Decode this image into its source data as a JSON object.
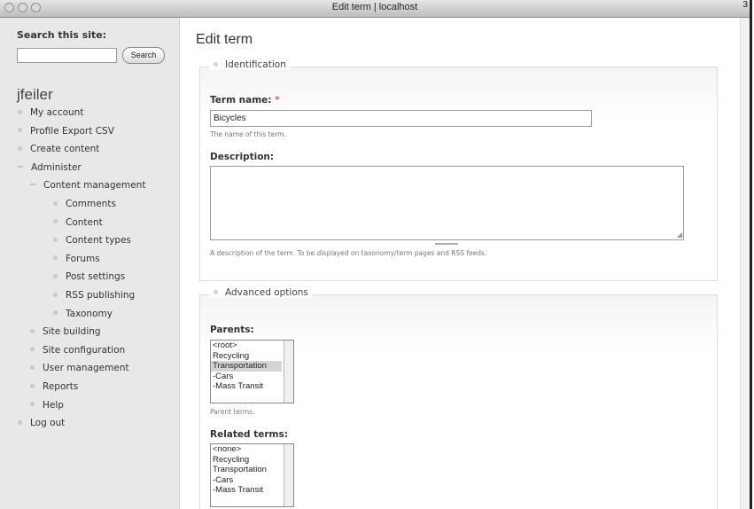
{
  "window": {
    "title": "Edit term | localhost",
    "corner_mark": "3"
  },
  "sidebar": {
    "search": {
      "label": "Search this site:",
      "value": "",
      "button": "Search"
    },
    "username": "jfeiler",
    "nav": [
      {
        "label": "My account",
        "level": 0
      },
      {
        "label": "Profile Export CSV",
        "level": 0
      },
      {
        "label": "Create content",
        "level": 0
      },
      {
        "label": "Administer",
        "level": 0,
        "expanded": true
      },
      {
        "label": "Content management",
        "level": 1,
        "expanded": true
      },
      {
        "label": "Comments",
        "level": 2
      },
      {
        "label": "Content",
        "level": 2
      },
      {
        "label": "Content types",
        "level": 2
      },
      {
        "label": "Forums",
        "level": 2
      },
      {
        "label": "Post settings",
        "level": 2
      },
      {
        "label": "RSS publishing",
        "level": 2
      },
      {
        "label": "Taxonomy",
        "level": 2
      },
      {
        "label": "Site building",
        "level": 1
      },
      {
        "label": "Site configuration",
        "level": 1
      },
      {
        "label": "User management",
        "level": 1
      },
      {
        "label": "Reports",
        "level": 1
      },
      {
        "label": "Help",
        "level": 1
      },
      {
        "label": "Log out",
        "level": 0
      }
    ]
  },
  "main": {
    "title": "Edit term",
    "identification": {
      "legend": "Identification",
      "term_name_label": "Term name:",
      "required_mark": "*",
      "term_name_value": "Bicycles",
      "term_name_desc": "The name of this term.",
      "description_label": "Description:",
      "description_value": "",
      "description_desc": "A description of the term. To be displayed on taxonomy/term pages and RSS feeds."
    },
    "advanced": {
      "legend": "Advanced options",
      "parents_label": "Parents:",
      "parents_options": [
        "<root>",
        "Recycling",
        "Transportation",
        "-Cars",
        "-Mass Transit"
      ],
      "parents_selected": "Transportation",
      "parents_desc": "Parent terms.",
      "related_label": "Related terms:",
      "related_options": [
        "<none>",
        "Recycling",
        "Transportation",
        "-Cars",
        "-Mass Transit"
      ]
    }
  }
}
